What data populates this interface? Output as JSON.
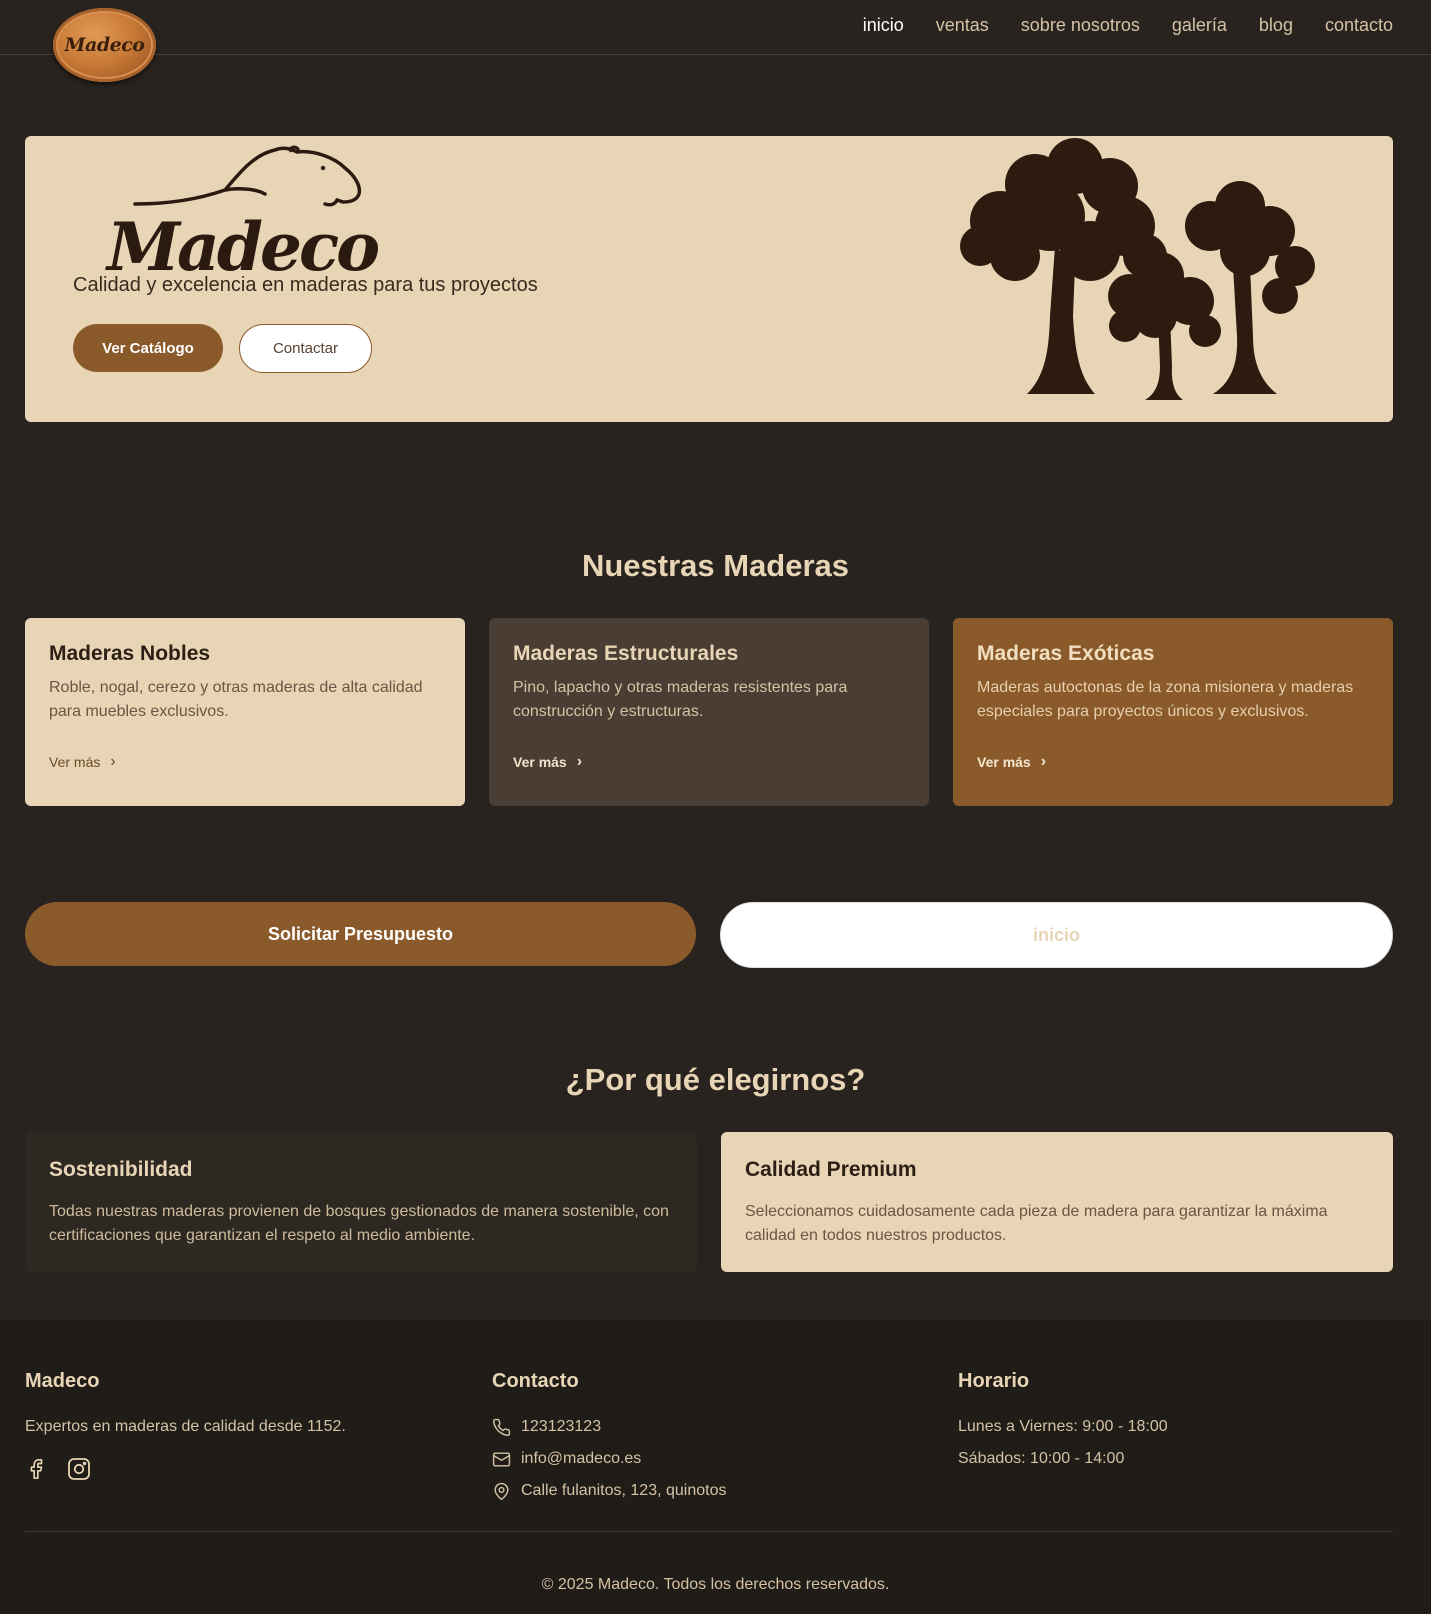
{
  "nav": {
    "logo_text": "Madeco",
    "links": [
      "inicio",
      "ventas",
      "sobre nosotros",
      "galería",
      "blog",
      "contacto"
    ],
    "active": "inicio"
  },
  "hero": {
    "brand": "Madeco",
    "tagline": "Calidad y excelencia en maderas para tus proyectos",
    "primary_button": "Ver Catálogo",
    "secondary_button": "Contactar"
  },
  "woods": {
    "title": "Nuestras Maderas",
    "cards": [
      {
        "title": "Maderas Nobles",
        "description": "Roble, nogal, cerezo y otras maderas de alta calidad para muebles exclusivos.",
        "link": "Ver más"
      },
      {
        "title": "Maderas Estructurales",
        "description": "Pino, lapacho y otras maderas resistentes para construcción y estructuras.",
        "link": "Ver más"
      },
      {
        "title": "Maderas Exóticas",
        "description": "Maderas autoctonas de la zona misionera y maderas especiales para proyectos únicos y exclusivos.",
        "link": "Ver más"
      }
    ]
  },
  "cta": {
    "quote_button": "Solicitar Presupuesto",
    "home_button": "inicio"
  },
  "why": {
    "title": "¿Por qué elegirnos?",
    "items": [
      {
        "title": "Sostenibilidad",
        "text": "Todas nuestras maderas provienen de bosques gestionados de manera sostenible, con certificaciones que garantizan el respeto al medio ambiente."
      },
      {
        "title": "Calidad Premium",
        "text": "Seleccionamos cuidadosamente cada pieza de madera para garantizar la máxima calidad en todos nuestros productos."
      }
    ]
  },
  "footer": {
    "about": {
      "title": "Madeco",
      "text": "Expertos en maderas de calidad desde 1152."
    },
    "social_icons": [
      "facebook-icon",
      "instagram-icon"
    ],
    "contact": {
      "title": "Contacto",
      "phone": "123123123",
      "email": "info@madeco.es",
      "address": "Calle fulanitos, 123, quinotos"
    },
    "hours": {
      "title": "Horario",
      "weekdays": "Lunes a Viernes: 9:00 - 18:00",
      "saturday": "Sábados: 10:00 - 14:00"
    },
    "copyright": "© 2025 Madeco. Todos los derechos reservados."
  },
  "colors": {
    "background": "#28231f",
    "beige": "#e8d5b5",
    "brown": "#8b5a2b",
    "dark_card": "#4a3e34",
    "footer": "#201c18"
  }
}
